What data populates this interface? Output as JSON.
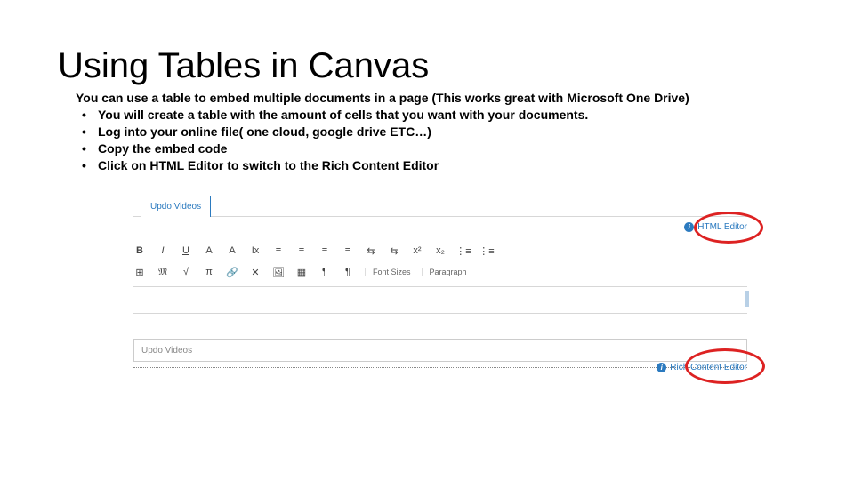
{
  "title": "Using Tables in Canvas",
  "description": "You can use a table to embed multiple documents in a page (This works great with Microsoft One Drive)",
  "bullets": [
    "You will create a table with the amount of cells that you want with your documents.",
    "Log into your online file( one cloud, google drive ETC…)",
    "Copy the embed code",
    "Click on HTML Editor to switch to the Rich Content Editor"
  ],
  "editor": {
    "tab_label": "Updo Videos",
    "html_editor_label": "HTML Editor",
    "rich_content_label": "Rich Content Editor",
    "input_placeholder": "Updo Videos",
    "font_sizes_label": "Font Sizes",
    "paragraph_label": "Paragraph",
    "icons_row1": [
      "B",
      "I",
      "U",
      "A",
      "A",
      "Ix",
      "≡",
      "≡",
      "≡",
      "≡",
      "⇆",
      "⇆",
      "x²",
      "x₂",
      "⋮≡",
      "⋮≡"
    ],
    "icons_row2": [
      "⊞",
      "𝔐",
      "√",
      "π",
      "🔗",
      "✕",
      "🖼",
      "▦",
      "¶",
      "¶"
    ]
  }
}
